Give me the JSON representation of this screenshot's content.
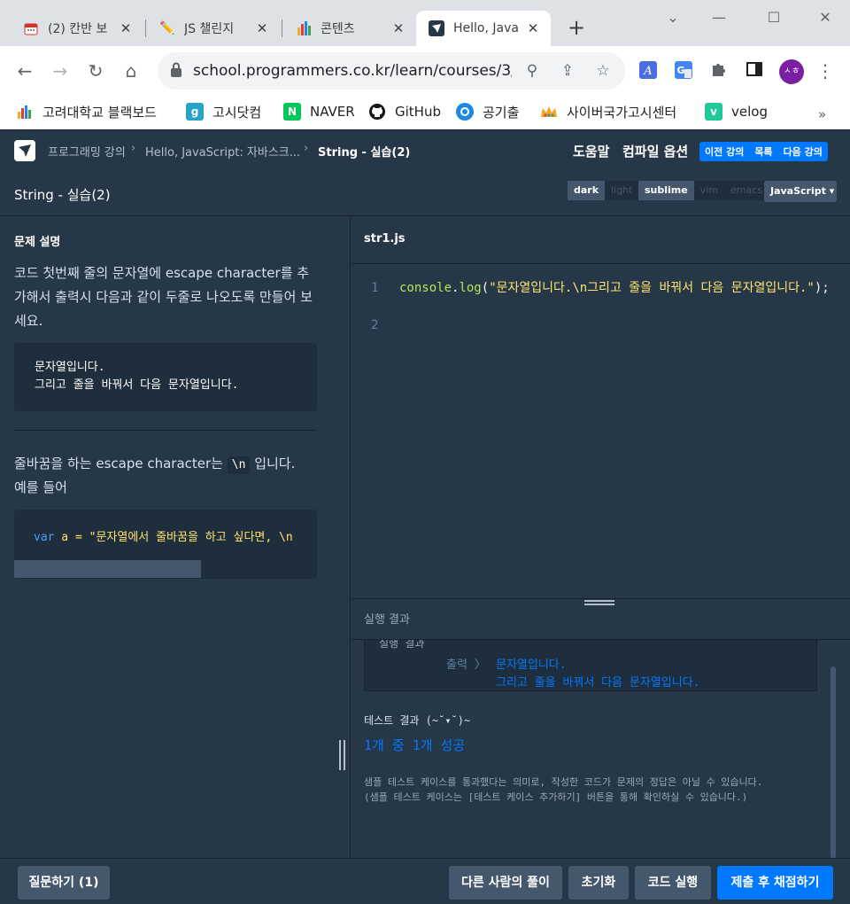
{
  "browser": {
    "tabs": [
      {
        "title": "(2) 칸반 보",
        "icon": "calendar-icon"
      },
      {
        "title": "JS 챌린지",
        "icon": "pencil-icon"
      },
      {
        "title": "콘텐츠",
        "icon": "bar-chart-icon"
      },
      {
        "title": "Hello, Java",
        "icon": "programmers-icon",
        "active": true
      }
    ],
    "url": "school.programmers.co.kr/learn/courses/3/l...",
    "avatar_initials": "ㅅㅎ",
    "bookmarks": [
      {
        "label": "고려대학교 블랙보드",
        "icon": "bar-chart-icon"
      },
      {
        "label": "고시닷컴",
        "icon": "g-icon"
      },
      {
        "label": "NAVER",
        "icon": "naver-icon"
      },
      {
        "label": "GitHub",
        "icon": "github-icon"
      },
      {
        "label": "공기출",
        "icon": "circle-icon"
      },
      {
        "label": "사이버국가고시센터",
        "icon": "crown-icon"
      },
      {
        "label": "velog",
        "icon": "velog-icon"
      }
    ],
    "bookmarks_more": "»"
  },
  "header": {
    "breadcrumbs": [
      "프로그래밍 강의",
      "Hello, JavaScript: 자바스크...",
      "String - 실습(2)"
    ],
    "help": "도움말",
    "compile_options": "컴파일 옵션",
    "lesson_nav": {
      "prev": "이전 강의",
      "list": "목록",
      "next": "다음 강의"
    }
  },
  "title_bar": {
    "title": "String - 실습(2)",
    "themes": [
      "dark",
      "light"
    ],
    "keymaps": [
      "sublime",
      "vim",
      "emacs"
    ],
    "language": "JavaScript ▾"
  },
  "problem": {
    "section_title": "문제 설명",
    "description": "코드 첫번째 줄의 문자열에 escape character를 추가해서 출력시 다음과 같이 두줄로 나오도록 만들어 보세요.",
    "example_output_line1": "문자열입니다.",
    "example_output_line2": "그리고 줄을 바꿔서 다음 문자열입니다.",
    "hint_prefix": "줄바꿈을 하는 escape character는",
    "hint_code": "\\n",
    "hint_suffix": "입니다.",
    "hint_line2": "예를 들어",
    "example_code_kw": "var",
    "example_code_rest": " a = \"문자열에서 줄바꿈을 하고 싶다면, \\n"
  },
  "editor": {
    "file_name": "str1.js",
    "line_numbers": [
      "1",
      "2"
    ],
    "code_fn": "console",
    "code_dot": ".",
    "code_method": "log",
    "code_open": "(",
    "code_string": "\"문자열입니다.\\n그리고 줄을 바꿔서 다음 문자열입니다.\"",
    "code_close": ");"
  },
  "result": {
    "title": "실행 결과",
    "cut_label": "실행 결과",
    "output_label": "출력 〉",
    "output_line1": "문자열입니다.",
    "output_line2": "그리고 줄을 바꿔서 다음 문자열입니다.",
    "test_header": "테스트 결과 (~˘▾˘)~",
    "test_summary": "1개 중 1개 성공",
    "note": "샘플 테스트 케이스를 통과했다는 의미로, 작성한 코드가 문제의 정답은 아닐 수 있습니다.\n(샘플 테스트 케이스는 [테스트 케이스 추가하기] 버튼을 통해 확인하실 수 있습니다.)"
  },
  "footer": {
    "ask": "질문하기 (1)",
    "others": "다른 사람의 풀이",
    "reset": "초기화",
    "run": "코드 실행",
    "submit": "제출 후 채점하기"
  },
  "colors": {
    "accent": "#0078ff",
    "background": "#263747",
    "panel": "#1e2e3d"
  }
}
